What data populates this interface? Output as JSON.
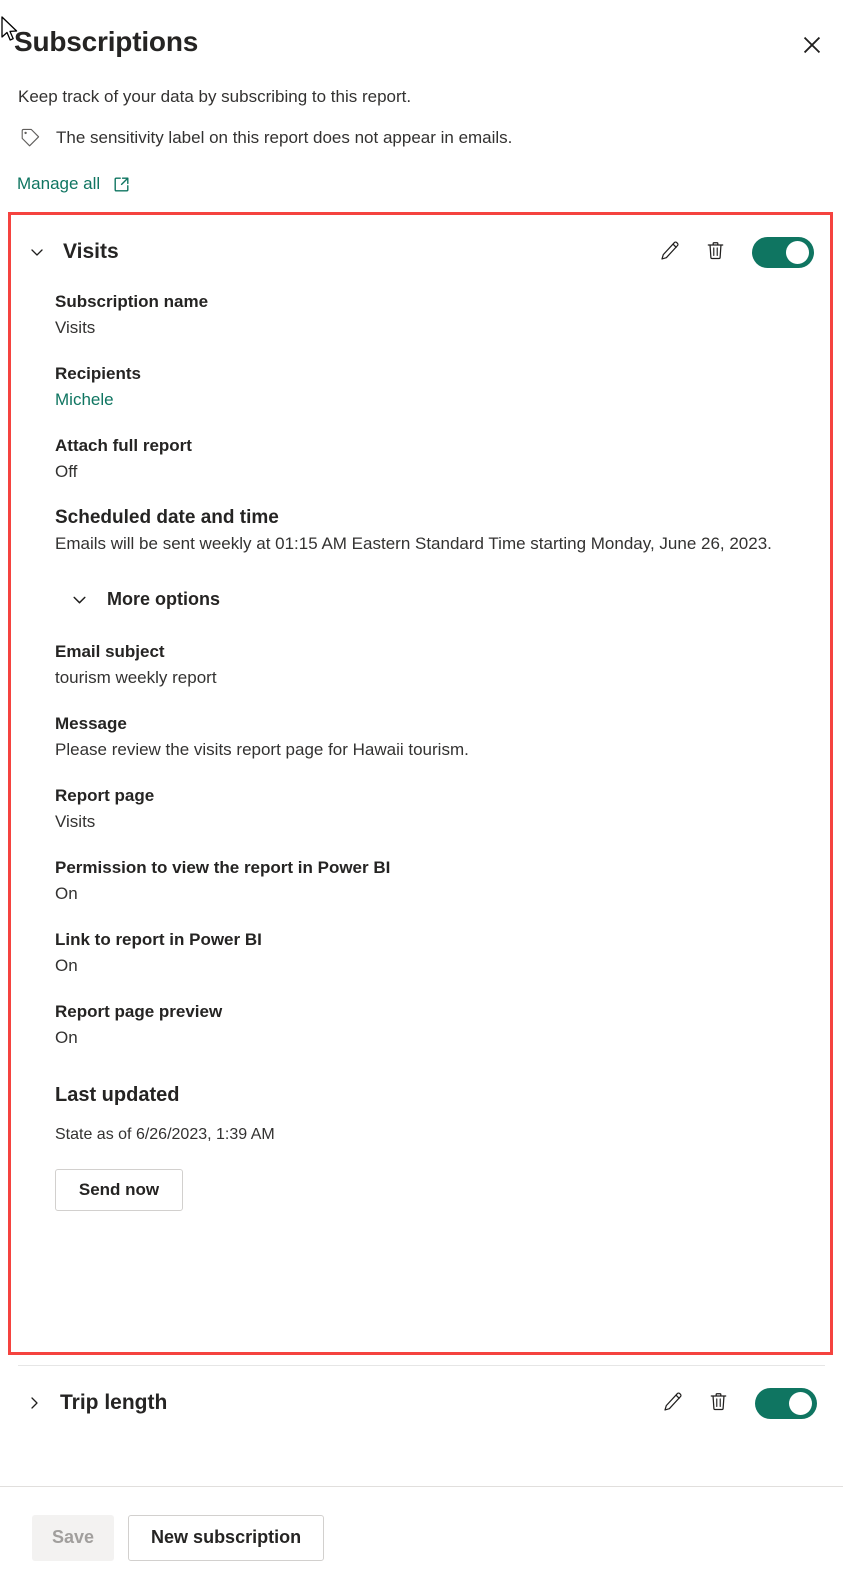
{
  "header": {
    "title": "Subscriptions",
    "subtitle": "Keep track of your data by subscribing to this report.",
    "sensitivity_notice": "The sensitivity label on this report does not appear in emails.",
    "manage_all_label": "Manage all",
    "close_icon": "close-icon",
    "tag_icon": "tag-icon",
    "external_link_icon": "external-link-icon"
  },
  "subscriptions": [
    {
      "name": "Visits",
      "expanded": true,
      "enabled": true,
      "edit_icon": "pencil-icon",
      "delete_icon": "trash-icon",
      "fields": {
        "subscription_name_label": "Subscription name",
        "subscription_name_value": "Visits",
        "recipients_label": "Recipients",
        "recipients_value": "Michele",
        "attach_full_report_label": "Attach full report",
        "attach_full_report_value": "Off",
        "scheduled_label": "Scheduled date and time",
        "scheduled_value": "Emails will be sent weekly at 01:15 AM Eastern Standard Time starting Monday, June 26, 2023.",
        "more_options_label": "More options",
        "email_subject_label": "Email subject",
        "email_subject_value": "tourism weekly report",
        "message_label": "Message",
        "message_value": "Please review the visits report page for Hawaii tourism.",
        "report_page_label": "Report page",
        "report_page_value": "Visits",
        "permission_label": "Permission to view the report in Power BI",
        "permission_value": "On",
        "link_label": "Link to report in Power BI",
        "link_value": "On",
        "preview_label": "Report page preview",
        "preview_value": "On",
        "last_updated_label": "Last updated",
        "last_updated_value": "State as of 6/26/2023, 1:39 AM",
        "send_now_label": "Send now"
      }
    },
    {
      "name": "Trip length",
      "expanded": false,
      "enabled": true,
      "edit_icon": "pencil-icon",
      "delete_icon": "trash-icon"
    }
  ],
  "footer": {
    "save_label": "Save",
    "save_disabled": true,
    "new_subscription_label": "New subscription"
  },
  "colors": {
    "accent_teal": "#0f7561",
    "highlight_red": "#f5433f",
    "text_primary": "#252423",
    "text_secondary": "#333231",
    "disabled_text": "#a19f9d"
  }
}
